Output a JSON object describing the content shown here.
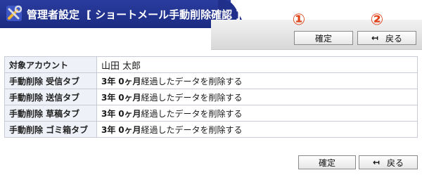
{
  "header": {
    "title": "管理者設定",
    "subtitle": "[ ショートメール手動削除確認 ]",
    "icon": "tools-icon",
    "colors": {
      "band": "#1f2f8a",
      "marker": "#e0441a"
    }
  },
  "markers": {
    "first": "①",
    "second": "②"
  },
  "top_buttons": {
    "confirm_label": "確定",
    "back_label": "戻る",
    "back_icon": "return-arrow-icon"
  },
  "table": {
    "account_label": "対象アカウント",
    "account_value": "山田 太郎",
    "rows": [
      {
        "label": "手動削除 受信タブ",
        "years": "3年",
        "months": "0ヶ月",
        "suffix": "経過したデータを削除する"
      },
      {
        "label": "手動削除 送信タブ",
        "years": "3年",
        "months": "0ヶ月",
        "suffix": "経過したデータを削除する"
      },
      {
        "label": "手動削除 草稿タブ",
        "years": "3年",
        "months": "0ヶ月",
        "suffix": "経過したデータを削除する"
      },
      {
        "label": "手動削除 ゴミ箱タブ",
        "years": "3年",
        "months": "0ヶ月",
        "suffix": "経過したデータを削除する"
      }
    ]
  },
  "bottom_buttons": {
    "confirm_label": "確定",
    "back_label": "戻る",
    "back_icon": "return-arrow-icon"
  }
}
